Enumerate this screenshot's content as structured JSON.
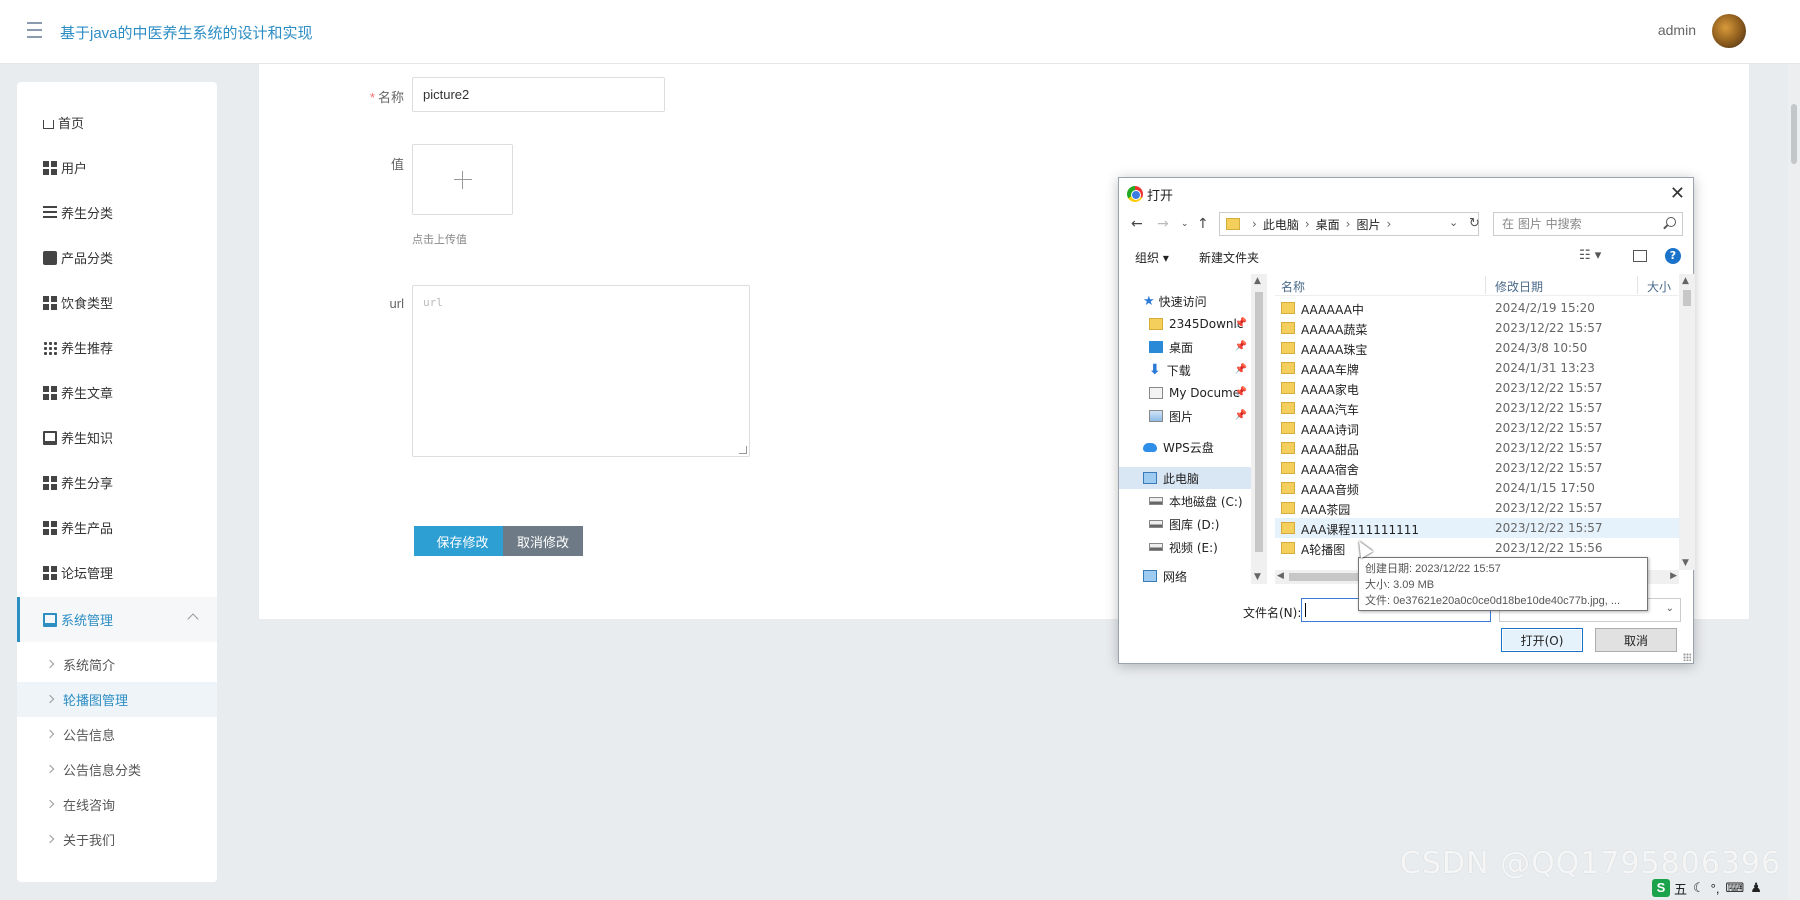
{
  "header": {
    "title": "基于java的中医养生系统的设计和实现",
    "user": "admin"
  },
  "sidebar": {
    "items": [
      {
        "label": "首页",
        "icon": "home-icon"
      },
      {
        "label": "用户",
        "icon": "grid-icon"
      },
      {
        "label": "养生分类",
        "icon": "list-icon"
      },
      {
        "label": "产品分类",
        "icon": "chat-icon"
      },
      {
        "label": "饮食类型",
        "icon": "grid-icon"
      },
      {
        "label": "养生推荐",
        "icon": "apps-icon"
      },
      {
        "label": "养生文章",
        "icon": "grid-icon"
      },
      {
        "label": "养生知识",
        "icon": "monitor-icon"
      },
      {
        "label": "养生分享",
        "icon": "grid-icon"
      },
      {
        "label": "养生产品",
        "icon": "grid-icon"
      },
      {
        "label": "论坛管理",
        "icon": "grid-icon"
      },
      {
        "label": "系统管理",
        "icon": "monitor-icon"
      }
    ],
    "sub_items": [
      "系统简介",
      "轮播图管理",
      "公告信息",
      "公告信息分类",
      "在线咨询",
      "关于我们"
    ]
  },
  "form": {
    "name_label": "名称",
    "name_value": "picture2",
    "value_label": "值",
    "upload_hint": "点击上传值",
    "url_label": "url",
    "url_placeholder": "url",
    "save_label": "保存修改",
    "cancel_label": "取消修改"
  },
  "dialog": {
    "title": "打开",
    "close": "✕",
    "path": [
      "此电脑",
      "桌面",
      "图片"
    ],
    "search_placeholder": "在 图片 中搜索",
    "organize": "组织 ▾",
    "new_folder": "新建文件夹",
    "tree": {
      "quick_access": "快速访问",
      "items": [
        "2345Downlc",
        "桌面",
        "下载",
        "My Docume",
        "图片"
      ],
      "wps": "WPS云盘",
      "this_pc": "此电脑",
      "drives": [
        "本地磁盘 (C:)",
        "图库 (D:)",
        "视频 (E:)"
      ],
      "network": "网络"
    },
    "columns": {
      "name": "名称",
      "date": "修改日期",
      "size": "大小"
    },
    "files": [
      {
        "name": "AAAAAA中",
        "date": "2024/2/19 15:20"
      },
      {
        "name": "AAAAA蔬菜",
        "date": "2023/12/22 15:57"
      },
      {
        "name": "AAAAA珠宝",
        "date": "2024/3/8 10:50"
      },
      {
        "name": "AAAA车牌",
        "date": "2024/1/31 13:23"
      },
      {
        "name": "AAAA家电",
        "date": "2023/12/22 15:57"
      },
      {
        "name": "AAAA汽车",
        "date": "2023/12/22 15:57"
      },
      {
        "name": "AAAA诗词",
        "date": "2023/12/22 15:57"
      },
      {
        "name": "AAAA甜品",
        "date": "2023/12/22 15:57"
      },
      {
        "name": "AAAA宿舍",
        "date": "2023/12/22 15:57"
      },
      {
        "name": "AAAA音频",
        "date": "2024/1/15 17:50"
      },
      {
        "name": "AAA茶园",
        "date": "2023/12/22 15:57"
      },
      {
        "name": "AAA课程111111111",
        "date": "2023/12/22 15:57"
      },
      {
        "name": "A轮播图",
        "date": "2023/12/22 15:56"
      }
    ],
    "tooltip": {
      "created": "创建日期: 2023/12/22 15:57",
      "size": "大小: 3.09 MB",
      "files": "文件: 0e37621e20a0c0ce0d18be10de40c77b.jpg, ..."
    },
    "filename_label": "文件名(N):",
    "open_label": "打开(O)",
    "cancel_label": "取消"
  },
  "watermark": "CSDN @QQ1795806396",
  "tray": {
    "ime": "五"
  }
}
